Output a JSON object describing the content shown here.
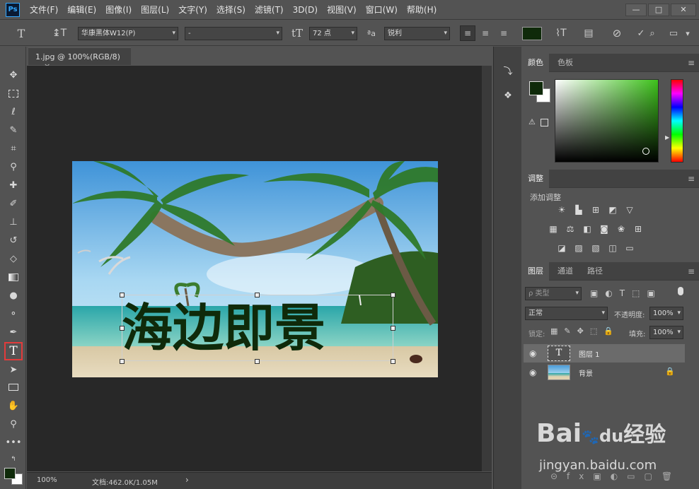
{
  "app": {
    "logo": "Ps"
  },
  "menu": [
    "文件(F)",
    "编辑(E)",
    "图像(I)",
    "图层(L)",
    "文字(Y)",
    "选择(S)",
    "滤镜(T)",
    "3D(D)",
    "视图(V)",
    "窗口(W)",
    "帮助(H)"
  ],
  "window_controls": {
    "minimize": "—",
    "maximize": "□",
    "close": "✕"
  },
  "options": {
    "font_family": "华康黑体W12(P)",
    "font_style": "-",
    "font_size": "72 点",
    "aa_label": "ªa",
    "antialias": "锐利",
    "text_color": "#0f2a0a"
  },
  "document": {
    "tab_title": "1.jpg @ 100%(RGB/8)",
    "close": "×",
    "text": "海边即景"
  },
  "status": {
    "zoom": "100%",
    "doc_info": "文档:462.0K/1.05M",
    "arrow": "›"
  },
  "panels": {
    "color": {
      "tabs": [
        "颜色",
        "色板"
      ],
      "fg": "#0f2a0a",
      "bg": "#ffffff"
    },
    "adjustments": {
      "tab": "调整",
      "title": "添加调整"
    },
    "layers": {
      "tabs": [
        "图层",
        "通道",
        "路径"
      ],
      "filter_label": "ρ 类型",
      "blend_mode": "正常",
      "opacity_label": "不透明度:",
      "opacity": "100%",
      "lock_label": "锁定:",
      "fill_label": "填充:",
      "fill": "100%",
      "items": [
        {
          "name": "图层 1",
          "thumb": "T"
        },
        {
          "name": "背景"
        }
      ]
    }
  },
  "watermark": {
    "brand": "Bai",
    "paw": "du",
    "cn": "经验",
    "url": "jingyan.baidu.com"
  }
}
